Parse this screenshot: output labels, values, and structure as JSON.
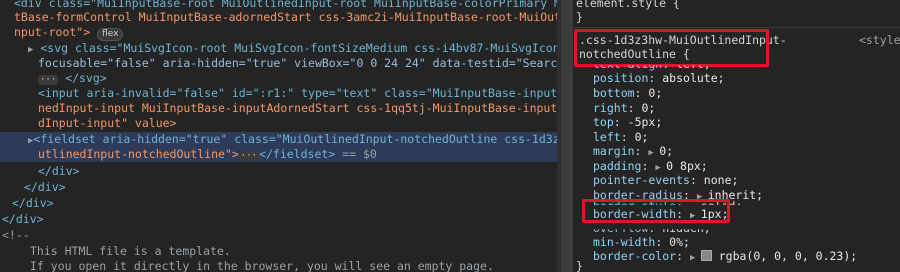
{
  "elements": {
    "l1": "<div class=\"MuiInputBase-root MuiOutlinedInput-root MuiInputBase-colorPrimary MuiInpu",
    "l2": "tBase-formControl MuiInputBase-adornedStart css-3amc2i-MuiInputBase-root-MuiOutlinedI",
    "l3": "nput-root\">",
    "flex_badge": "flex",
    "l4_a": "<svg class=\"MuiSvgIcon-root MuiSvgIcon-fontSizeMedium css-i4bv87-MuiSvgIcon-root\"",
    "l5": "focusable=\"false\" aria-hidden=\"true\" viewBox=\"0 0 24 24\" data-testid=\"SearchIcon\">",
    "l6_close": "</svg>",
    "l7": "<input aria-invalid=\"false\" id=\":r1:\" type=\"text\" class=\"MuiInputBase-input MuiOutli",
    "l8": "nedInput-input MuiInputBase-inputAdornedStart css-1qq5tj-MuiInputBase-input-MuiOutline",
    "l9": "dInput-input\" value>",
    "l10": "<fieldset aria-hidden=\"true\" class=\"MuiOutlinedInput-notchedOutline css-1d3z3hw-MuiO",
    "l11": "utlinedInput-notchedOutline\">",
    "l11_close": "</fieldset>",
    "l11_eq": " == $0",
    "l12": "</div>",
    "l13": "</div>",
    "l14": "</div>",
    "l15": "</div>",
    "l16": "<!--",
    "l17": "This HTML file is a template.",
    "l18": "If you open it directly in the browser, you will see an empty page."
  },
  "styles": {
    "element_style": "element.style {",
    "close1": "}",
    "selector_l1": ".css-1d3z3hw-MuiOutlinedInput-",
    "selector_l2": "notchedOutline {",
    "source": "<style>",
    "rules": [
      {
        "prop": "text-align",
        "val": "left;"
      },
      {
        "prop": "position",
        "val": "absolute;"
      },
      {
        "prop": "bottom",
        "val": "0;"
      },
      {
        "prop": "right",
        "val": "0;"
      },
      {
        "prop": "top",
        "val": "-5px;"
      },
      {
        "prop": "left",
        "val": "0;"
      },
      {
        "prop": "margin",
        "val": "0;"
      },
      {
        "prop": "padding",
        "val": "0 8px;"
      },
      {
        "prop": "pointer-events",
        "val": "none;"
      },
      {
        "prop": "border-radius",
        "val": "inherit;"
      },
      {
        "prop": "border-style",
        "val": "solid;"
      },
      {
        "prop": "border-width",
        "val": "1px;"
      },
      {
        "prop": "overflow",
        "val": "hidden;"
      },
      {
        "prop": "min-width",
        "val": "0%;"
      },
      {
        "prop": "border-color",
        "val": "rgba(0, 0, 0, 0.23);"
      }
    ],
    "close2": "}"
  },
  "colors": {
    "highlight": "#e0142b",
    "selected_row": "#2d3a5a"
  }
}
